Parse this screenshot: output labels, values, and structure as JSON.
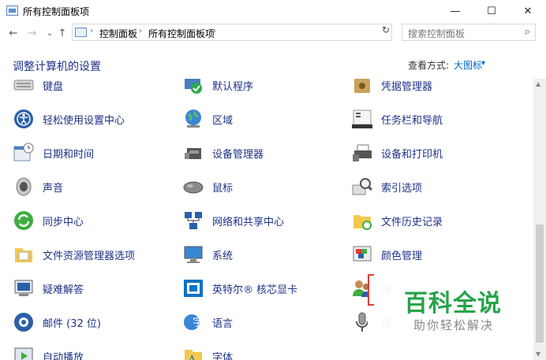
{
  "window": {
    "title": "所有控制面板项",
    "controls": {
      "minimize": "—",
      "maximize": "☐",
      "close": "✕"
    }
  },
  "nav": {
    "back": "←",
    "forward": "→",
    "recent": "⌄",
    "up": "↑",
    "breadcrumb": [
      "控制面板",
      "所有控制面板项"
    ],
    "separator": "›",
    "dropdown": "⌄",
    "refresh": "↻",
    "search_placeholder": "搜索控制面板"
  },
  "header": {
    "title": "调整计算机的设置",
    "view_label": "查看方式:",
    "view_value": "大图标",
    "view_caret": "▾"
  },
  "items": [
    {
      "label": "键盘",
      "icon": "keyboard-icon"
    },
    {
      "label": "默认程序",
      "icon": "default-programs-icon"
    },
    {
      "label": "凭据管理器",
      "icon": "credential-manager-icon"
    },
    {
      "label": "轻松使用设置中心",
      "icon": "ease-of-access-icon"
    },
    {
      "label": "区域",
      "icon": "region-globe-icon"
    },
    {
      "label": "任务栏和导航",
      "icon": "taskbar-icon"
    },
    {
      "label": "日期和时间",
      "icon": "calendar-clock-icon"
    },
    {
      "label": "设备管理器",
      "icon": "device-manager-icon"
    },
    {
      "label": "设备和打印机",
      "icon": "printer-icon"
    },
    {
      "label": "声音",
      "icon": "speaker-icon"
    },
    {
      "label": "鼠标",
      "icon": "mouse-icon"
    },
    {
      "label": "索引选项",
      "icon": "index-search-icon"
    },
    {
      "label": "同步中心",
      "icon": "sync-center-icon"
    },
    {
      "label": "网络和共享中心",
      "icon": "network-icon"
    },
    {
      "label": "文件历史记录",
      "icon": "file-history-icon"
    },
    {
      "label": "文件资源管理器选项",
      "icon": "folder-options-icon"
    },
    {
      "label": "系统",
      "icon": "system-monitor-icon"
    },
    {
      "label": "颜色管理",
      "icon": "color-management-icon"
    },
    {
      "label": "疑难解答",
      "icon": "troubleshooting-icon"
    },
    {
      "label": "英特尔® 核芯显卡",
      "icon": "intel-graphics-icon"
    },
    {
      "label": "用",
      "icon": "user-accounts-icon"
    },
    {
      "label": "邮件 (32 位)",
      "icon": "mail-icon"
    },
    {
      "label": "语言",
      "icon": "language-icon"
    },
    {
      "label": "语",
      "icon": "speech-microphone-icon"
    },
    {
      "label": "自动播放",
      "icon": "autoplay-icon"
    },
    {
      "label": "字体",
      "icon": "fonts-icon"
    }
  ],
  "watermark": {
    "main": "百科全说",
    "sub": "助你轻松解决"
  },
  "scrollbar": {
    "up": "▲",
    "down": "▼"
  }
}
